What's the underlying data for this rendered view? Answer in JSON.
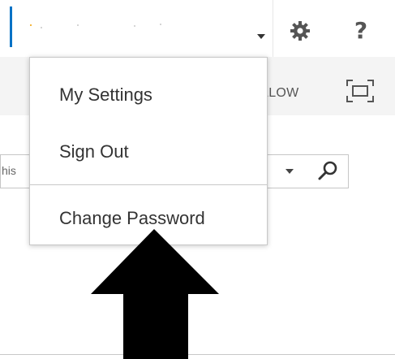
{
  "suite_bar": {
    "icons": {
      "account": "chevron-down-icon",
      "settings": "gear-icon",
      "help": "help-icon"
    },
    "help_label": "?"
  },
  "ribbon": {
    "follow_label": "LLOW",
    "focus_icon": "focus-on-content-icon"
  },
  "search": {
    "visible_text": "his",
    "icons": {
      "scope": "chevron-down-icon",
      "search": "search-icon"
    }
  },
  "account_menu": {
    "items": [
      {
        "label": "My Settings"
      },
      {
        "label": "Sign Out"
      },
      {
        "label": "Change Password"
      }
    ]
  },
  "annotation": {
    "arrow_icon": "up-arrow-icon",
    "color": "#000000"
  },
  "colors": {
    "accent": "#0072c6",
    "menu_border": "#c8c8c8",
    "ribbon_bg": "#f4f4f4",
    "text": "#333333"
  }
}
